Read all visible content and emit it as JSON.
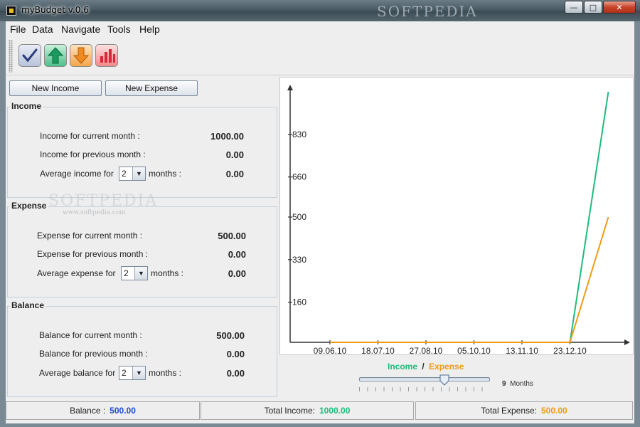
{
  "window": {
    "title": "myBudget v.0.6",
    "watermark": "SOFTPEDIA"
  },
  "menu": [
    "File",
    "Data",
    "Navigate",
    "Tools",
    "Help"
  ],
  "toolbar": {
    "icons": [
      "check-icon",
      "up-arrow-icon",
      "down-arrow-icon",
      "bar-chart-icon"
    ]
  },
  "buttons": {
    "new_income": "New Income",
    "new_expense": "New Expense"
  },
  "income": {
    "title": "Income",
    "current_label": "Income for current month :",
    "current_value": "1000.00",
    "previous_label": "Income for previous month :",
    "previous_value": "0.00",
    "avg_label": "Average income for",
    "avg_months": "2",
    "avg_suffix": "months :",
    "avg_value": "0.00"
  },
  "expense": {
    "title": "Expense",
    "current_label": "Expense for current month :",
    "current_value": "500.00",
    "previous_label": "Expense for previous month :",
    "previous_value": "0.00",
    "avg_label": "Average expense for",
    "avg_months": "2",
    "avg_suffix": "months :",
    "avg_value": "0.00"
  },
  "balance": {
    "title": "Balance",
    "current_label": "Balance for current month :",
    "current_value": "500.00",
    "previous_label": "Balance for previous month :",
    "previous_value": "0.00",
    "avg_label": "Average balance for",
    "avg_months": "2",
    "avg_suffix": "months :",
    "avg_value": "0.00"
  },
  "watermark2": {
    "main": "SOFTPEDIA",
    "url": "www.softpedia.com"
  },
  "chart_data": {
    "type": "line",
    "x": [
      "09.06.10",
      "18.07.10",
      "27.08.10",
      "05.10.10",
      "13.11.10",
      "23.12.10"
    ],
    "y_ticks": [
      160,
      330,
      500,
      660,
      830
    ],
    "y_tick_labels": [
      "160",
      "330",
      "500",
      "660",
      "830"
    ],
    "ylim": [
      0,
      1000
    ],
    "series": [
      {
        "name": "Income",
        "color": "#1dbb7a",
        "points": [
          [
            "09.06.10",
            0
          ],
          [
            "18.07.10",
            0
          ],
          [
            "27.08.10",
            0
          ],
          [
            "05.10.10",
            0
          ],
          [
            "13.11.10",
            0
          ],
          [
            "23.12.10",
            0
          ],
          [
            "end",
            1000
          ]
        ]
      },
      {
        "name": "Expense",
        "color": "#f09a18",
        "points": [
          [
            "09.06.10",
            0
          ],
          [
            "18.07.10",
            0
          ],
          [
            "27.08.10",
            0
          ],
          [
            "05.10.10",
            0
          ],
          [
            "13.11.10",
            0
          ],
          [
            "23.12.10",
            0
          ],
          [
            "end",
            500
          ]
        ]
      }
    ],
    "legend_separator": "/",
    "grid": false
  },
  "slider": {
    "value": "9",
    "unit": "Months"
  },
  "status": {
    "balance_label": "Balance :",
    "balance_value": "500.00",
    "balance_color": "#1a4fc8",
    "income_label": "Total Income:",
    "income_value": "1000.00",
    "income_color": "#1dbb7a",
    "expense_label": "Total Expense:",
    "expense_value": "500.00",
    "expense_color": "#f09a18"
  }
}
